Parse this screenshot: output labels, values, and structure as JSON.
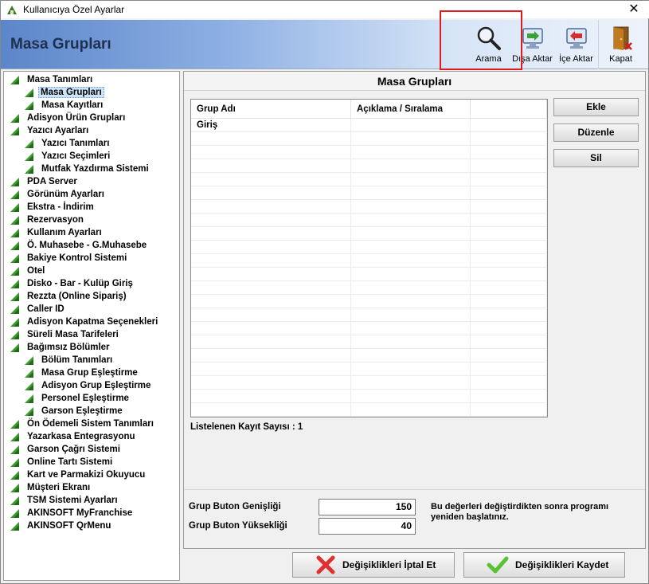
{
  "window": {
    "title": "Kullanıcıya Özel Ayarlar",
    "close_glyph": "✕"
  },
  "header": {
    "title": "Masa Grupları"
  },
  "toolbar": {
    "buttons": [
      {
        "label": "Arama",
        "icon": "magnifier-icon"
      },
      {
        "label": "Dışa Aktar",
        "icon": "export-monitor-icon"
      },
      {
        "label": "İçe Aktar",
        "icon": "import-monitor-icon"
      },
      {
        "label": "Kapat",
        "icon": "door-close-icon"
      }
    ]
  },
  "tree": {
    "items": [
      {
        "label": "Masa Tanımları",
        "level": 1
      },
      {
        "label": "Masa Grupları",
        "level": 2,
        "selected": true
      },
      {
        "label": "Masa Kayıtları",
        "level": 2
      },
      {
        "label": "Adisyon Ürün Grupları",
        "level": 1
      },
      {
        "label": "Yazıcı Ayarları",
        "level": 1
      },
      {
        "label": "Yazıcı Tanımları",
        "level": 2
      },
      {
        "label": "Yazıcı Seçimleri",
        "level": 2
      },
      {
        "label": "Mutfak Yazdırma Sistemi",
        "level": 2
      },
      {
        "label": "PDA Server",
        "level": 1
      },
      {
        "label": "Görünüm Ayarları",
        "level": 1
      },
      {
        "label": "Ekstra - İndirim",
        "level": 1
      },
      {
        "label": "Rezervasyon",
        "level": 1
      },
      {
        "label": "Kullanım Ayarları",
        "level": 1
      },
      {
        "label": "Ö. Muhasebe - G.Muhasebe",
        "level": 1
      },
      {
        "label": "Bakiye Kontrol Sistemi",
        "level": 1
      },
      {
        "label": "Otel",
        "level": 1
      },
      {
        "label": "Disko - Bar - Kulüp Giriş",
        "level": 1
      },
      {
        "label": "Rezzta (Online Sipariş)",
        "level": 1
      },
      {
        "label": "Caller ID",
        "level": 1
      },
      {
        "label": "Adisyon Kapatma Seçenekleri",
        "level": 1
      },
      {
        "label": "Süreli Masa Tarifeleri",
        "level": 1
      },
      {
        "label": "Bağımsız Bölümler",
        "level": 1
      },
      {
        "label": "Bölüm Tanımları",
        "level": 2
      },
      {
        "label": "Masa Grup Eşleştirme",
        "level": 2
      },
      {
        "label": "Adisyon Grup Eşleştirme",
        "level": 2
      },
      {
        "label": "Personel Eşleştirme",
        "level": 2
      },
      {
        "label": "Garson Eşleştirme",
        "level": 2
      },
      {
        "label": "Ön Ödemeli Sistem Tanımları",
        "level": 1
      },
      {
        "label": "Yazarkasa Entegrasyonu",
        "level": 1
      },
      {
        "label": "Garson Çağrı Sistemi",
        "level": 1
      },
      {
        "label": "Online Tartı Sistemi",
        "level": 1
      },
      {
        "label": "Kart ve Parmakizi Okuyucu",
        "level": 1
      },
      {
        "label": "Müşteri Ekranı",
        "level": 1
      },
      {
        "label": "TSM Sistemi Ayarları",
        "level": 1
      },
      {
        "label": "AKINSOFT MyFranchise",
        "level": 1
      },
      {
        "label": "AKINSOFT QrMenu",
        "level": 1
      }
    ]
  },
  "main": {
    "section_title": "Masa Grupları",
    "grid": {
      "columns": [
        "Grup Adı",
        "Açıklama / Sıralama",
        ""
      ],
      "rows": [
        [
          "Giriş",
          "",
          ""
        ]
      ]
    },
    "buttons": {
      "add": "Ekle",
      "edit": "Düzenle",
      "delete": "Sil"
    },
    "record_count": "Listelenen Kayıt Sayısı : 1",
    "settings": {
      "width_label": "Grup Buton Genişliği",
      "width_value": "150",
      "height_label": "Grup Buton Yüksekliği",
      "height_value": "40",
      "note": "Bu değerleri değiştirdikten sonra programı yeniden başlatınız."
    }
  },
  "footer": {
    "cancel_label": "Değişiklikleri İptal Et",
    "save_label": "Değişiklikleri Kaydet"
  },
  "colors": {
    "header_gradient_start": "#5b86c9",
    "highlight_border": "#e01b1b",
    "tree_triangle": "#3a9a2a",
    "cancel_icon": "#e03030",
    "save_icon": "#5bc236"
  }
}
